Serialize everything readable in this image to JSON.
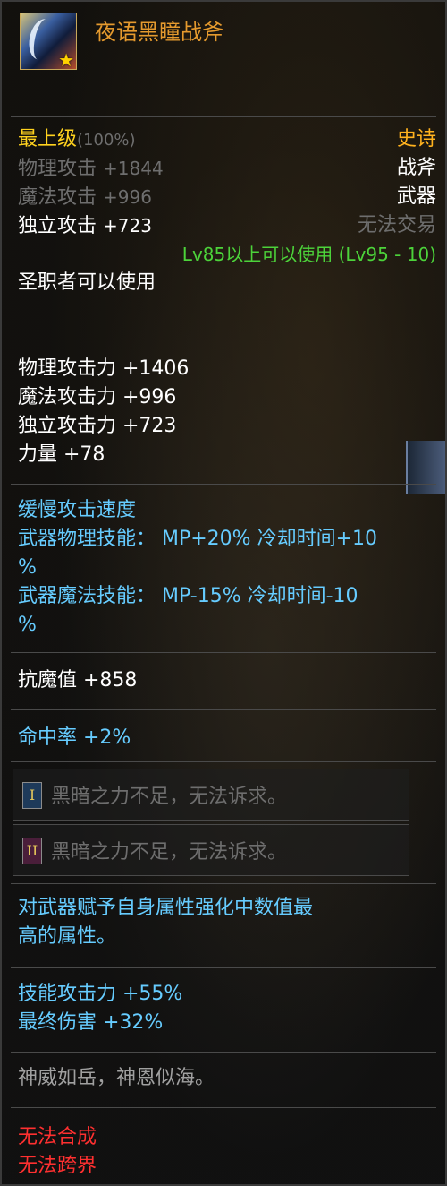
{
  "item": {
    "name": "夜语黑瞳战斧",
    "icon": "axe-item-icon",
    "grade": "最上级",
    "grade_pct": "(100%)",
    "rarity": "史诗",
    "type": "战斧",
    "category": "武器",
    "trade": "无法交易",
    "base_stats": [
      {
        "label": "物理攻击",
        "value": "+1844"
      },
      {
        "label": "魔法攻击",
        "value": "+996"
      },
      {
        "label": "独立攻击",
        "value": "+723"
      }
    ],
    "level_req": "Lv85以上可以使用 (Lv95 - 10)",
    "class_req": "圣职者可以使用",
    "bonus_stats": [
      "物理攻击力 +1406",
      "魔法攻击力 +996",
      "独立攻击力 +723",
      "力量 +78"
    ],
    "speed": "缓慢攻击速度",
    "skill_phys_1": "武器物理技能： MP+20% 冷却时间+10",
    "skill_phys_2": "%",
    "skill_mag_1": "武器魔法技能： MP-15% 冷却时间-10",
    "skill_mag_2": "%",
    "anti_magic": "抗魔值 +858",
    "hit_rate": "命中率 +2%",
    "socket_1": {
      "badge": "I",
      "text": "黑暗之力不足，无法诉求。"
    },
    "socket_2": {
      "badge": "II",
      "text": "黑暗之力不足，无法诉求。"
    },
    "element_1": "对武器赋予自身属性强化中数值最",
    "element_2": "高的属性。",
    "skill_atk": "技能攻击力 +55%",
    "final_dmg": "最终伤害 +32%",
    "flavor": "神威如岳，神恩似海。",
    "no_synth": "无法合成",
    "no_cross": "无法跨界"
  },
  "colors": {
    "title": "#e59a2e",
    "grade": "#ffd21e",
    "level": "#4cd33a",
    "effect": "#66ccff",
    "warning": "#ff3030"
  }
}
